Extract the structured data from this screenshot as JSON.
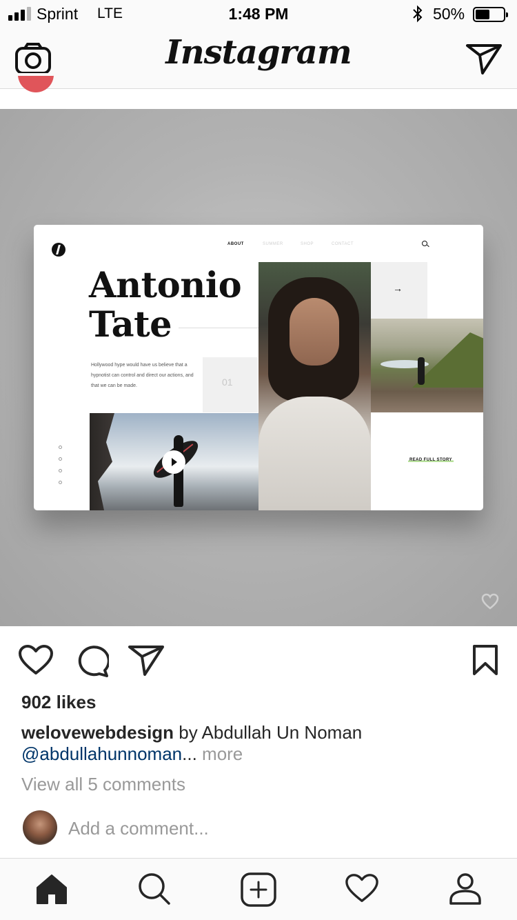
{
  "status_bar": {
    "carrier": "Sprint",
    "network": "LTE",
    "time": "1:48 PM",
    "battery_percent": "50%",
    "battery_level": 0.5,
    "signal_bars": 3
  },
  "header": {
    "logo": "Instagram",
    "left_icon": "camera-icon",
    "right_icon": "direct-message-icon"
  },
  "post": {
    "image": {
      "nav": [
        "ABOUT",
        "SUMMER",
        "SHOP",
        "CONTACT"
      ],
      "name_line1": "Antonio",
      "name_line2": "Tate",
      "description": "Hollywood hype would have us believe that a hypnotist can control and direct our actions, and that we can be made.",
      "number": "01",
      "arrow": "→",
      "cta": "READ FULL STORY"
    },
    "likes": "902 likes",
    "caption": {
      "username": "welovewebdesign",
      "text": " by Abdullah Un Noman",
      "mention": "@abdullahunnoman",
      "ellipsis": "...",
      "more": "more"
    },
    "view_comments": "View all 5 comments",
    "comment_placeholder": "Add a comment..."
  },
  "actions": [
    "heart-icon",
    "comment-icon",
    "share-icon",
    "bookmark-icon"
  ],
  "tabbar": [
    "home-icon",
    "search-icon",
    "new-post-icon",
    "activity-icon",
    "profile-icon"
  ],
  "colors": {
    "text": "#262626",
    "muted": "#999999",
    "link": "#003569",
    "bar_bg": "#fafafa",
    "divider": "#dbdbdb"
  }
}
